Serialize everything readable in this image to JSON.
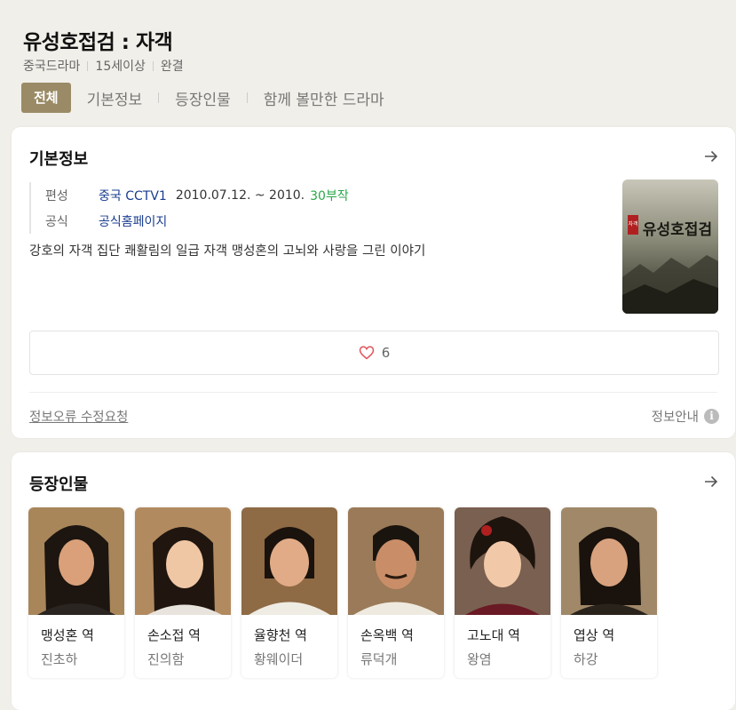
{
  "drama": {
    "title": "유성호접검 : 자객",
    "meta": [
      "중국드라마",
      "15세이상",
      "완결"
    ]
  },
  "tabs": [
    "전체",
    "기본정보",
    "등장인물",
    "함께 볼만한 드라마"
  ],
  "basic_info": {
    "section_title": "기본정보",
    "rows": [
      {
        "label": "편성",
        "channel": "중국 CCTV1",
        "period": "2010.07.12. ~ 2010.",
        "episodes": "30부작"
      },
      {
        "label": "공식",
        "value": "공식홈페이지"
      }
    ],
    "description": "강호의 자객 집단 쾌활림의 일급 자객 맹성혼의 고뇌와 사랑을 그린 이야기",
    "poster_text": "유성호접검",
    "poster_seal": "자객",
    "like_count": "6",
    "report_link": "정보오류 수정요청",
    "info_guide": "정보안내",
    "info_icon": "i"
  },
  "characters": {
    "section_title": "등장인물",
    "cast": [
      {
        "role": "맹성혼 역",
        "actor": "진초하"
      },
      {
        "role": "손소접 역",
        "actor": "진의함"
      },
      {
        "role": "율향천 역",
        "actor": "황웨이더"
      },
      {
        "role": "손옥백 역",
        "actor": "류덕개"
      },
      {
        "role": "고노대 역",
        "actor": "왕염"
      },
      {
        "role": "엽상 역",
        "actor": "하강"
      }
    ]
  },
  "colors": {
    "accent": "#9a8b66",
    "link": "#1a3d8f",
    "episodes_green": "#2aa74a",
    "heart": "#e0555a"
  }
}
